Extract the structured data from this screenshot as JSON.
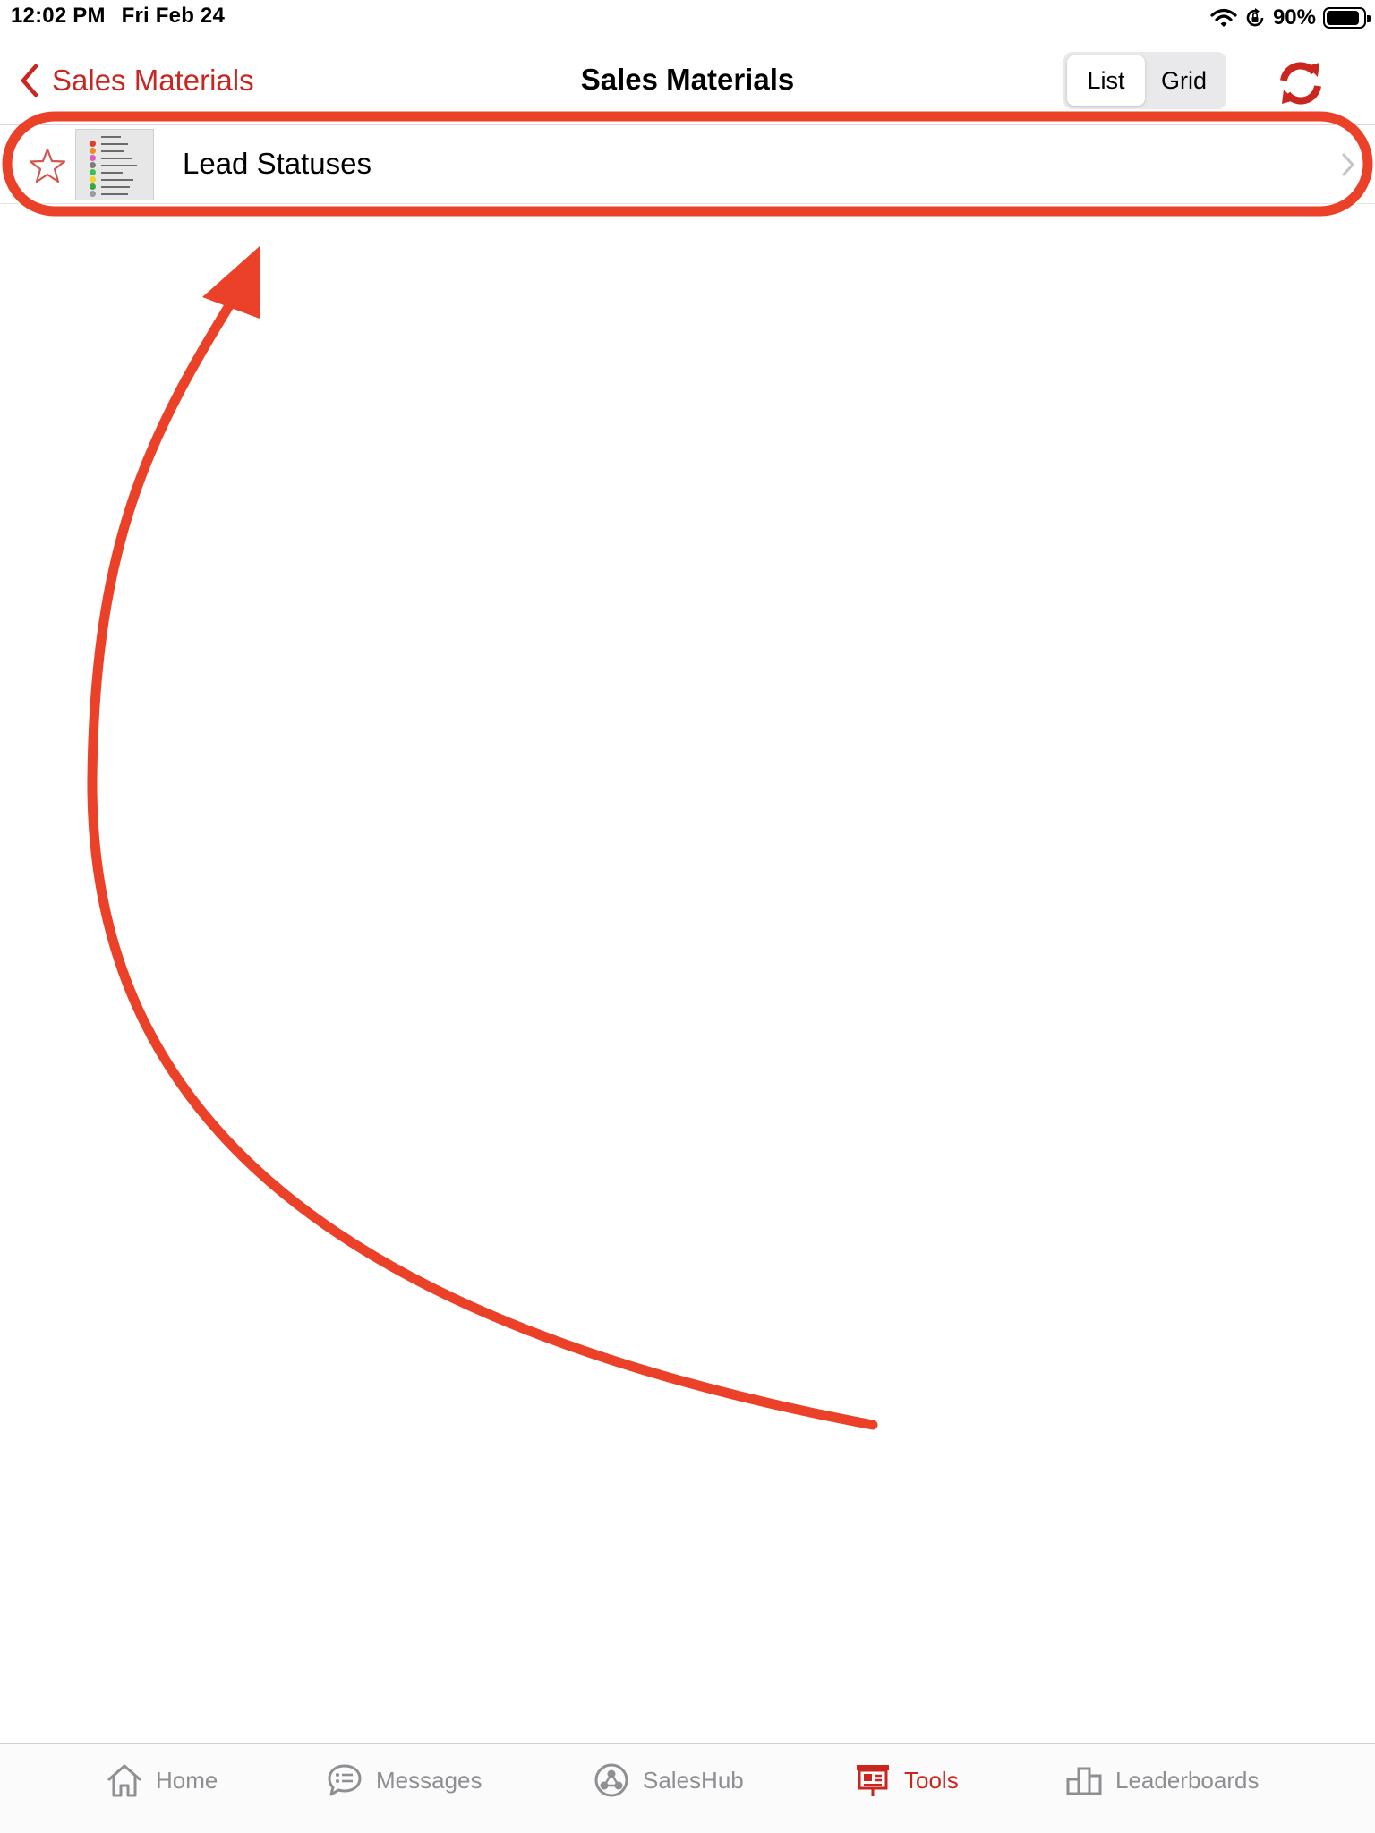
{
  "status_bar": {
    "time": "12:02 PM",
    "date": "Fri Feb 24",
    "battery_percent": "90%",
    "battery_level": 0.9
  },
  "nav": {
    "back_label": "Sales Materials",
    "title": "Sales Materials",
    "view_options": [
      "List",
      "Grid"
    ],
    "selected_view": "List"
  },
  "list": {
    "items": [
      {
        "label": "Lead Statuses",
        "favorite": false
      }
    ]
  },
  "tabs": [
    {
      "label": "Home",
      "icon": "home-icon",
      "active": false
    },
    {
      "label": "Messages",
      "icon": "messages-icon",
      "active": false
    },
    {
      "label": "SalesHub",
      "icon": "saleshub-icon",
      "active": false
    },
    {
      "label": "Tools",
      "icon": "tools-icon",
      "active": true
    },
    {
      "label": "Leaderboards",
      "icon": "leaderboards-icon",
      "active": false
    }
  ],
  "colors": {
    "accent": "#c8261f",
    "annotation": "#ea4128",
    "inactive_tab": "#8e8e93"
  }
}
